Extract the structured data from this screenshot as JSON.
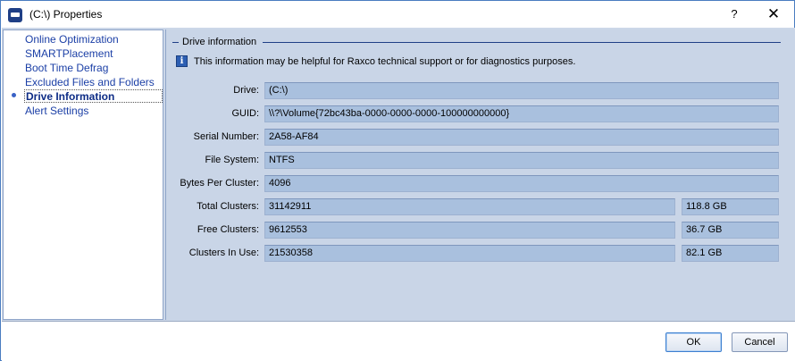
{
  "window": {
    "title": "(C:\\) Properties",
    "help_label": "?",
    "close_label": "✕"
  },
  "sidebar": {
    "items": [
      {
        "label": "Online Optimization",
        "active": false
      },
      {
        "label": "SMARTPlacement",
        "active": false
      },
      {
        "label": "Boot Time Defrag",
        "active": false
      },
      {
        "label": "Excluded Files and Folders",
        "active": false
      },
      {
        "label": "Drive Information",
        "active": true
      },
      {
        "label": "Alert Settings",
        "active": false
      }
    ]
  },
  "content": {
    "group_title": "Drive information",
    "info_icon_glyph": "i",
    "info_text": "This information may be helpful for Raxco technical support or for diagnostics purposes.",
    "fields": {
      "drive": {
        "label": "Drive:",
        "value": "(C:\\)"
      },
      "guid": {
        "label": "GUID:",
        "value": "\\\\?\\Volume{72bc43ba-0000-0000-0000-100000000000}"
      },
      "serial": {
        "label": "Serial Number:",
        "value": "2A58-AF84"
      },
      "filesystem": {
        "label": "File System:",
        "value": "NTFS"
      },
      "bytes_per_cluster": {
        "label": "Bytes Per Cluster:",
        "value": "4096"
      },
      "total_clusters": {
        "label": "Total Clusters:",
        "value": "31142911",
        "size": "118.8 GB"
      },
      "free_clusters": {
        "label": "Free Clusters:",
        "value": "9612553",
        "size": "36.7 GB"
      },
      "clusters_in_use": {
        "label": "Clusters In Use:",
        "value": "21530358",
        "size": "82.1 GB"
      }
    }
  },
  "footer": {
    "ok_label": "OK",
    "cancel_label": "Cancel"
  }
}
